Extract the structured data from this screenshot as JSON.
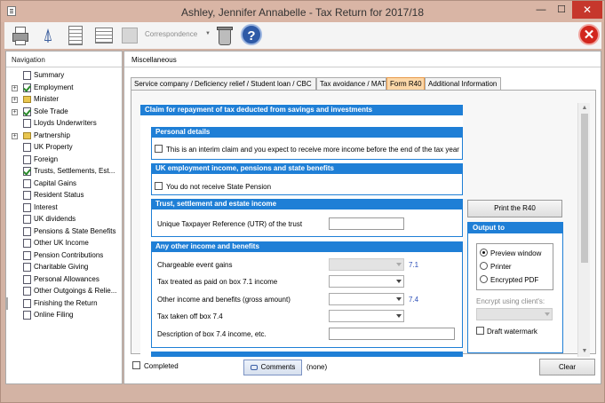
{
  "window": {
    "title": "Ashley, Jennifer Annabelle - Tax Return for 2017/18",
    "min": "—",
    "max": "☐",
    "close": "✕"
  },
  "toolbar": {
    "correspondence_label": "Correspondence",
    "help_glyph": "?",
    "stop_glyph": "✕"
  },
  "navigation": {
    "title": "Navigation",
    "items": [
      {
        "label": "Summary",
        "expand": "",
        "icon": "doc"
      },
      {
        "label": "Employment",
        "expand": "+",
        "icon": "check"
      },
      {
        "label": "Minister",
        "expand": "+",
        "icon": "folder"
      },
      {
        "label": "Sole Trade",
        "expand": "+",
        "icon": "check"
      },
      {
        "label": "Lloyds Underwriters",
        "expand": "",
        "icon": "doc"
      },
      {
        "label": "Partnership",
        "expand": "+",
        "icon": "folder"
      },
      {
        "label": "UK Property",
        "expand": "",
        "icon": "doc"
      },
      {
        "label": "Foreign",
        "expand": "",
        "icon": "doc"
      },
      {
        "label": "Trusts, Settlements, Est...",
        "expand": "",
        "icon": "check"
      },
      {
        "label": "Capital Gains",
        "expand": "",
        "icon": "doc"
      },
      {
        "label": "Resident Status",
        "expand": "",
        "icon": "doc"
      },
      {
        "label": "Interest",
        "expand": "",
        "icon": "doc"
      },
      {
        "label": "UK dividends",
        "expand": "",
        "icon": "doc"
      },
      {
        "label": "Pensions & State Benefits",
        "expand": "",
        "icon": "doc"
      },
      {
        "label": "Other UK Income",
        "expand": "",
        "icon": "doc"
      },
      {
        "label": "Pension Contributions",
        "expand": "",
        "icon": "doc"
      },
      {
        "label": "Charitable Giving",
        "expand": "",
        "icon": "doc"
      },
      {
        "label": "Personal Allowances",
        "expand": "",
        "icon": "doc"
      },
      {
        "label": "Other Outgoings & Relie...",
        "expand": "",
        "icon": "doc"
      },
      {
        "label": "Miscellaneous",
        "expand": "",
        "icon": "doc",
        "selected": true
      },
      {
        "label": "Finishing the Return",
        "expand": "",
        "icon": "doc"
      },
      {
        "label": "Online Filing",
        "expand": "",
        "icon": "doc"
      }
    ]
  },
  "main": {
    "title": "Miscellaneous",
    "tabs": [
      {
        "label": "Service company / Deficiency relief / Student loan / CBC"
      },
      {
        "label": "Tax avoidance / MAT"
      },
      {
        "label": "Form R40",
        "active": true
      },
      {
        "label": "Additional Information"
      }
    ],
    "form": {
      "heading": "Claim for repayment of tax deducted from savings and investments",
      "personal": {
        "title": "Personal details",
        "interim_label": "This is an interim claim and you expect to receive more income before the end of the tax year"
      },
      "uk_employment": {
        "title": "UK employment income, pensions and state benefits",
        "no_state_pension_label": "You do not receive State Pension"
      },
      "trust": {
        "title": "Trust, settlement and estate income",
        "utr_label": "Unique Taxpayer Reference (UTR) of the trust",
        "utr_value": ""
      },
      "other_income": {
        "title": "Any other income and benefits",
        "chargeable_label": "Chargeable event gains",
        "chargeable_ref": "7.1",
        "tax_treated_label": "Tax treated as paid on box 7.1 income",
        "other_income_label": "Other income and benefits (gross amount)",
        "other_income_ref": "7.4",
        "tax_taken_label": "Tax taken off box 7.4",
        "description_label": "Description of box 7.4 income, etc."
      }
    },
    "print_button": "Print the R40",
    "output": {
      "title": "Output to",
      "options": [
        "Preview window",
        "Printer",
        "Encrypted PDF"
      ],
      "selected": "Preview window",
      "encrypt_label": "Encrypt using client's:",
      "draft_label": "Draft watermark"
    },
    "completed_label": "Completed",
    "comments_button": "Comments",
    "comments_value": "(none)",
    "clear_button": "Clear"
  },
  "colors": {
    "accent": "#1f7fd6",
    "active_tab": "#fcd7a8",
    "close_red": "#c6372c"
  }
}
